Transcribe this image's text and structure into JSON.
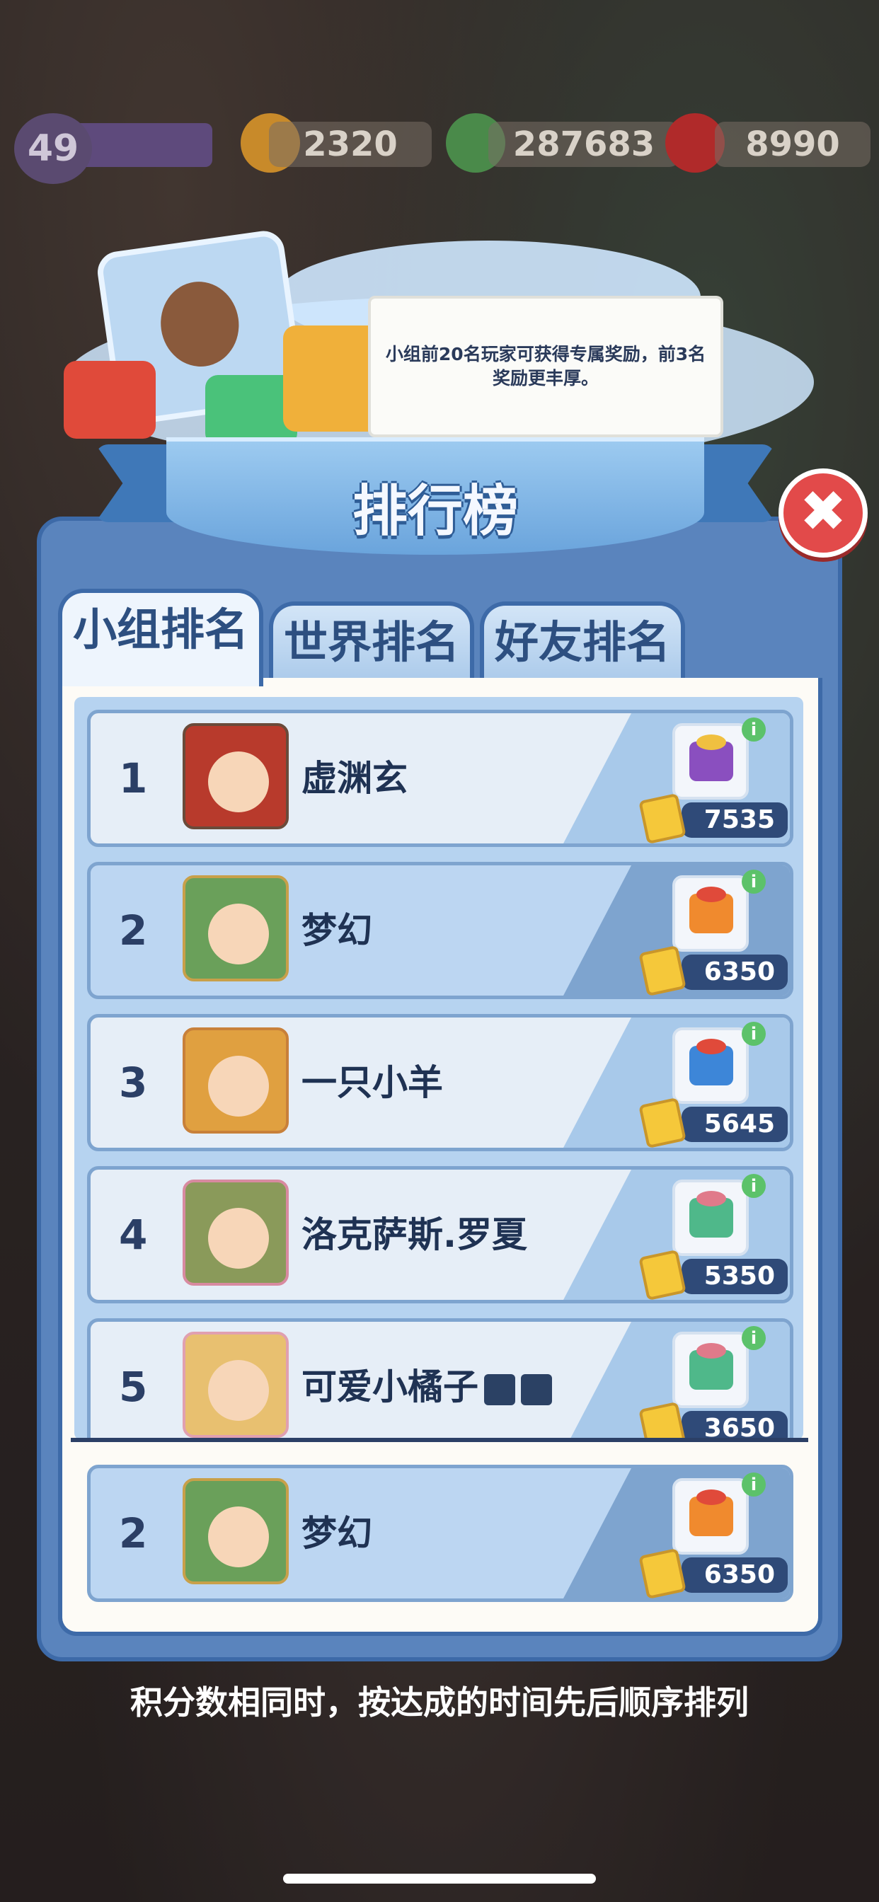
{
  "topbar": {
    "level": "49",
    "energy": "2320",
    "cash": "287683",
    "gems": "8990"
  },
  "banner": {
    "notice": "小组前20名玩家可获得专属奖励，前3名奖励更丰厚。"
  },
  "title": "排行榜",
  "tabs": [
    {
      "label": "小组排名",
      "active": true
    },
    {
      "label": "世界排名",
      "active": false
    },
    {
      "label": "好友排名",
      "active": false
    }
  ],
  "rows": [
    {
      "rank": "1",
      "name": "虚渊玄",
      "score": "7535",
      "gift_color": "#8a4fbf",
      "avatar_color": "#b83a2c"
    },
    {
      "rank": "2",
      "name": "梦幻",
      "score": "6350",
      "gift_color": "#f08a2e",
      "avatar_color": "#6aa05a"
    },
    {
      "rank": "3",
      "name": "一只小羊",
      "score": "5645",
      "gift_color": "#3d86d8",
      "avatar_color": "#e0a040"
    },
    {
      "rank": "4",
      "name": "洛克萨斯.罗夏",
      "score": "5350",
      "gift_color": "#4fb88a",
      "avatar_color": "#8a9a5a"
    },
    {
      "rank": "5",
      "name": "可爱小橘子",
      "score": "3650",
      "gift_color": "#4fb88a",
      "avatar_color": "#e8c070"
    }
  ],
  "self_row": {
    "rank": "2",
    "name": "梦幻",
    "score": "6350",
    "gift_color": "#f08a2e",
    "avatar_color": "#6aa05a"
  },
  "info_glyph": "i",
  "close_glyph": "✖",
  "footer": "积分数相同时，按达成的时间先后顺序排列"
}
